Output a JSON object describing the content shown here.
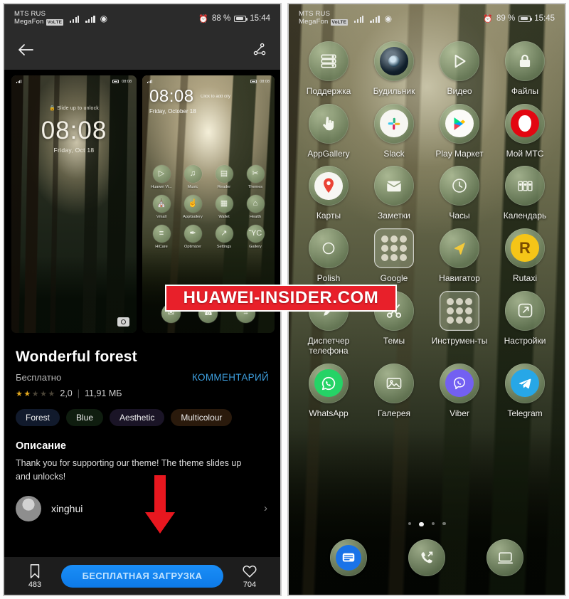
{
  "watermark": {
    "text": "HUAWEI-INSIDER.COM",
    "bg": "#e8202a",
    "fg": "#ffffff"
  },
  "left_phone": {
    "status_bar": {
      "carrier_line1": "MTS RUS",
      "carrier_line2": "MegaFon",
      "volte_badge": "VoLTE",
      "alarm_icon": "alarm-icon",
      "battery_percent": "88 %",
      "clock": "15:44"
    },
    "toolbar": {
      "back_icon": "back-arrow-icon",
      "share_icon": "share-icon"
    },
    "previews": [
      {
        "kind": "lock-screen",
        "mini_status_time": "08:08",
        "hint": "Slide up to unlock",
        "time": "08:08",
        "date": "Friday, Oct 18",
        "camera_shortcut": "camera-icon"
      },
      {
        "kind": "home-screen",
        "mini_status_time": "08:08",
        "time": "08:08",
        "add_city": "Click to add city",
        "date": "Friday, October 18",
        "apps": [
          {
            "label": "Huawei Vi...",
            "icon": "video-icon",
            "glyph": "▷"
          },
          {
            "label": "Music",
            "icon": "music-icon",
            "glyph": "♫"
          },
          {
            "label": "Reader",
            "icon": "reader-icon",
            "glyph": "▤"
          },
          {
            "label": "Themes",
            "icon": "themes-icon",
            "glyph": "✂"
          },
          {
            "label": "Vmall",
            "icon": "vmall-icon",
            "glyph": "⛪"
          },
          {
            "label": "AppGallery",
            "icon": "appgallery-icon",
            "glyph": "☝"
          },
          {
            "label": "Wallet",
            "icon": "wallet-icon",
            "glyph": "▦"
          },
          {
            "label": "Health",
            "icon": "health-icon",
            "glyph": "⌂"
          },
          {
            "label": "HiCare",
            "icon": "hicare-icon",
            "glyph": "≡"
          },
          {
            "label": "Optimizer",
            "icon": "optimizer-icon",
            "glyph": "✒"
          },
          {
            "label": "Settings",
            "icon": "settings-icon",
            "glyph": "↗"
          },
          {
            "label": "Gallery",
            "icon": "gallery-icon",
            "glyph": "ὛC"
          }
        ],
        "dock": [
          {
            "label": "Messages",
            "icon": "messages-icon",
            "glyph": "✉"
          },
          {
            "label": "Phone",
            "icon": "phone-icon",
            "glyph": "☎"
          },
          {
            "label": "Browser",
            "icon": "browser-icon",
            "glyph": "⌗"
          }
        ]
      }
    ],
    "details": {
      "title": "Wonderful forest",
      "price": "Бесплатно",
      "comment_link": "КОММЕНТАРИЙ",
      "rating_value": "2,0",
      "rating_stars_filled": 2,
      "rating_stars_total": 5,
      "separator": "|",
      "file_size": "11,91 МБ",
      "tags": [
        {
          "label": "Forest",
          "bg": "#111a2c"
        },
        {
          "label": "Blue",
          "bg": "#0f1d0f"
        },
        {
          "label": "Aesthetic",
          "bg": "#1a1426"
        },
        {
          "label": "Multicolour",
          "bg": "#2a1a0c"
        }
      ],
      "description_heading": "Описание",
      "description_body": "Thank you for supporting our theme! The theme slides up and unlocks!",
      "author_name": "xinghui",
      "author_chevron": "chevron-right-icon"
    },
    "bottom_bar": {
      "bookmark_icon": "bookmark-icon",
      "bookmark_count": "483",
      "download_button": "БЕСПЛАТНАЯ ЗАГРУЗКА",
      "download_button_color": "#1a8ef7",
      "favorite_icon": "heart-icon",
      "favorite_count": "704"
    }
  },
  "right_phone": {
    "status_bar": {
      "carrier_line1": "MTS RUS",
      "carrier_line2": "MegaFon",
      "volte_badge": "VoLTE",
      "alarm_icon": "alarm-icon",
      "battery_percent": "89 %",
      "clock": "15:45"
    },
    "apps": [
      {
        "label": "Поддержка",
        "icon": "support-icon",
        "glyph": "≣",
        "style": "plain"
      },
      {
        "label": "Будильник",
        "icon": "alarm-clock-icon",
        "glyph": "⏰",
        "style": "brand-dark"
      },
      {
        "label": "Видео",
        "icon": "video-icon",
        "glyph": "▷",
        "style": "plain"
      },
      {
        "label": "Файлы",
        "icon": "files-lock-icon",
        "glyph": "🔒",
        "style": "plain"
      },
      {
        "label": "AppGallery",
        "icon": "appgallery-icon",
        "glyph": "☝",
        "style": "plain"
      },
      {
        "label": "Slack",
        "icon": "slack-icon",
        "glyph": "#",
        "style": "brand-slack"
      },
      {
        "label": "Play Маркет",
        "icon": "play-store-icon",
        "glyph": "▶",
        "style": "brand-play"
      },
      {
        "label": "Мой МТС",
        "icon": "mts-icon",
        "glyph": "●",
        "style": "brand-mts"
      },
      {
        "label": "Карты",
        "icon": "maps-pin-icon",
        "glyph": "📍",
        "style": "brand-maps"
      },
      {
        "label": "Заметки",
        "icon": "notes-envelope-icon",
        "glyph": "✉",
        "style": "plain"
      },
      {
        "label": "Часы",
        "icon": "clock-icon",
        "glyph": "◷",
        "style": "plain"
      },
      {
        "label": "Календарь",
        "icon": "calendar-icon",
        "glyph": "⌸",
        "style": "plain"
      },
      {
        "label": "Polish",
        "icon": "polish-icon",
        "glyph": "○",
        "style": "plain"
      },
      {
        "label": "Google",
        "icon": "google-folder-icon",
        "glyph": "",
        "style": "folder"
      },
      {
        "label": "Навигатор",
        "icon": "navigator-icon",
        "glyph": "➤",
        "style": "brand-nav"
      },
      {
        "label": "Rutaxi",
        "icon": "rutaxi-icon",
        "glyph": "R",
        "style": "brand-rutaxi"
      },
      {
        "label": "Диспетчер телефона",
        "icon": "phone-manager-icon",
        "glyph": "✒",
        "style": "plain"
      },
      {
        "label": "Темы",
        "icon": "themes-icon",
        "glyph": "✂",
        "style": "plain"
      },
      {
        "label": "Инструмен-ты",
        "icon": "tools-folder-icon",
        "glyph": "",
        "style": "folder"
      },
      {
        "label": "Настройки",
        "icon": "settings-icon",
        "glyph": "↗",
        "style": "plain"
      },
      {
        "label": "WhatsApp",
        "icon": "whatsapp-icon",
        "glyph": "✆",
        "style": "brand-whatsapp"
      },
      {
        "label": "Галерея",
        "icon": "gallery-icon",
        "glyph": "⛰",
        "style": "plain"
      },
      {
        "label": "Viber",
        "icon": "viber-icon",
        "glyph": "✆",
        "style": "brand-viber"
      },
      {
        "label": "Telegram",
        "icon": "telegram-icon",
        "glyph": "➤",
        "style": "brand-telegram"
      }
    ],
    "page_dots": {
      "total": 4,
      "active_index": 1
    },
    "dock": [
      {
        "label": "Messages",
        "icon": "messages-icon",
        "glyph": "⌸",
        "style": "brand-messages"
      },
      {
        "label": "Phone",
        "icon": "phone-call-icon",
        "glyph": "✆",
        "style": "plain"
      },
      {
        "label": "Browser",
        "icon": "browser-icon",
        "glyph": "⎕",
        "style": "plain"
      }
    ]
  }
}
